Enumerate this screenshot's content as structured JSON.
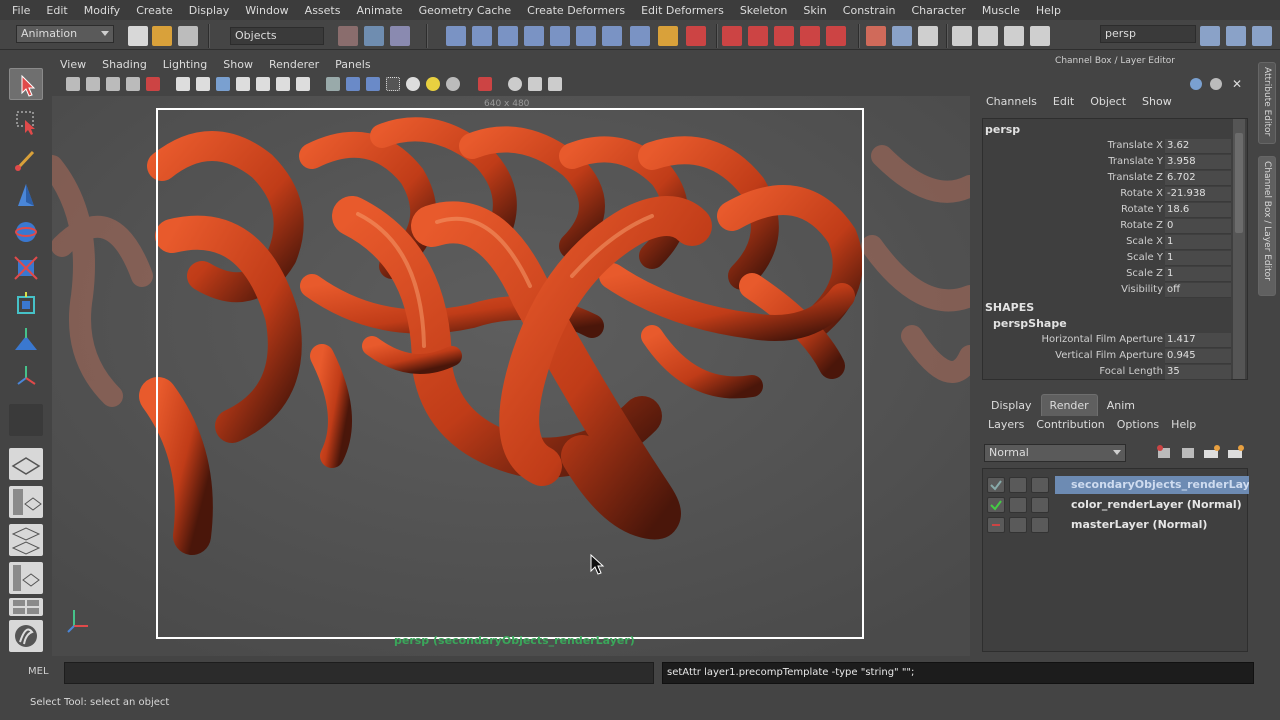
{
  "menubar": [
    "File",
    "Edit",
    "Modify",
    "Create",
    "Display",
    "Window",
    "Assets",
    "Animate",
    "Geometry Cache",
    "Create Deformers",
    "Edit Deformers",
    "Skeleton",
    "Skin",
    "Constrain",
    "Character",
    "Muscle",
    "Help"
  ],
  "statusline": {
    "menuset": "Animation",
    "selection_mode": "Objects",
    "camera_field": "persp"
  },
  "panel_menu": [
    "View",
    "Shading",
    "Lighting",
    "Show",
    "Renderer",
    "Panels"
  ],
  "viewport": {
    "resolution_label": "640 x 480",
    "camera_label": "persp (secondaryObjects_renderLayer)"
  },
  "right_panel": {
    "title": "Channel Box / Layer Editor",
    "channel_menu": [
      "Channels",
      "Edit",
      "Object",
      "Show"
    ],
    "node": "persp",
    "channels": [
      {
        "label": "Translate X",
        "value": "3.62"
      },
      {
        "label": "Translate Y",
        "value": "3.958"
      },
      {
        "label": "Translate Z",
        "value": "6.702"
      },
      {
        "label": "Rotate X",
        "value": "-21.938"
      },
      {
        "label": "Rotate Y",
        "value": "18.6"
      },
      {
        "label": "Rotate Z",
        "value": "0"
      },
      {
        "label": "Scale X",
        "value": "1"
      },
      {
        "label": "Scale Y",
        "value": "1"
      },
      {
        "label": "Scale Z",
        "value": "1"
      },
      {
        "label": "Visibility",
        "value": "off"
      }
    ],
    "shapes_header": "SHAPES",
    "shape_node": "perspShape",
    "shape_channels": [
      {
        "label": "Horizontal Film Aperture",
        "value": "1.417"
      },
      {
        "label": "Vertical Film Aperture",
        "value": "0.945"
      },
      {
        "label": "Focal Length",
        "value": "35"
      }
    ],
    "layer_tabs": [
      "Display",
      "Render",
      "Anim"
    ],
    "active_tab": "Render",
    "layer_menu": [
      "Layers",
      "Contribution",
      "Options",
      "Help"
    ],
    "blend_mode": "Normal",
    "layers": [
      {
        "name": "secondaryObjects_renderLayer",
        "selected": true
      },
      {
        "name": "color_renderLayer (Normal)",
        "selected": false
      },
      {
        "name": "masterLayer (Normal)",
        "selected": false
      }
    ]
  },
  "side_tabs": [
    "Attribute Editor",
    "Channel Box / Layer Editor"
  ],
  "command_line": {
    "label": "MEL",
    "input": "",
    "result": "setAttr layer1.precompTemplate -type \"string\" \"\";"
  },
  "help_line": "Select Tool: select an object",
  "colors": {
    "accent": "#6d8bb3",
    "camera_label": "#3aa65a",
    "tube": "#c8421e"
  }
}
